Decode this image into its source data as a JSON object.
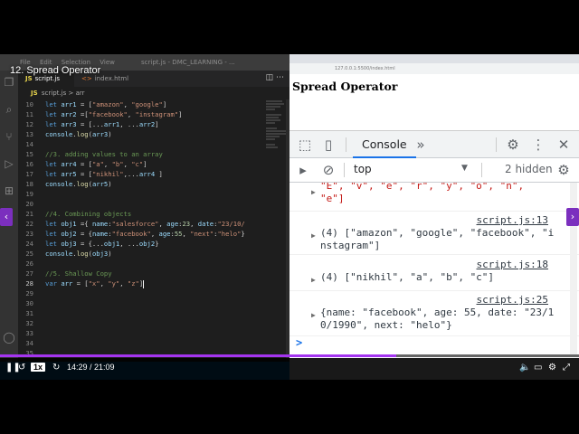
{
  "video": {
    "title": "12. Spread Operator",
    "speed": "1x",
    "time": "14:29 / 21:09",
    "progress": 0.685
  },
  "vscode": {
    "menu": [
      "File",
      "Edit",
      "Selection",
      "View"
    ],
    "window_title": "script.js - DMC_LEARNING - ...",
    "tabs": [
      {
        "icon": "JS",
        "label": "script.js"
      },
      {
        "icon": "<>",
        "label": "index.html"
      }
    ],
    "breadcrumb": {
      "icon": "JS",
      "file": "script.js",
      "sep": ">",
      "symbol": "arr"
    },
    "lines": [
      {
        "n": "10",
        "t": "let arr1 = [\"amazon\", \"google\"]"
      },
      {
        "n": "11",
        "t": "let arr2 =[\"facebook\", \"instagram\"]"
      },
      {
        "n": "12",
        "t": "let arr3 = [...arr1, ...arr2]"
      },
      {
        "n": "13",
        "t": "console.log(arr3)"
      },
      {
        "n": "14",
        "t": ""
      },
      {
        "n": "15",
        "t": "//3. adding values to an array"
      },
      {
        "n": "16",
        "t": "let arr4 = [\"a\", \"b\", \"c\"]"
      },
      {
        "n": "17",
        "t": "let arr5 = [\"nikhil\",...arr4 ]"
      },
      {
        "n": "18",
        "t": "console.log(arr5)"
      },
      {
        "n": "19",
        "t": ""
      },
      {
        "n": "20",
        "t": ""
      },
      {
        "n": "21",
        "t": "//4. Combining objects"
      },
      {
        "n": "22",
        "t": "let obj1 ={ name:\"salesforce\", age:23, date:\"23/10/"
      },
      {
        "n": "23",
        "t": "let obj2 = {name:\"facebook\", age:55, \"next\":\"helo\"}"
      },
      {
        "n": "24",
        "t": "let obj3 = {...obj1, ...obj2}"
      },
      {
        "n": "25",
        "t": "console.log(obj3)"
      },
      {
        "n": "26",
        "t": ""
      },
      {
        "n": "27",
        "t": "//5. Shallow Copy"
      },
      {
        "n": "28",
        "t": "var arr = [\"x\", \"y\", \"z\"]"
      },
      {
        "n": "29",
        "t": ""
      },
      {
        "n": "30",
        "t": ""
      },
      {
        "n": "31",
        "t": ""
      },
      {
        "n": "32",
        "t": ""
      },
      {
        "n": "33",
        "t": ""
      },
      {
        "n": "34",
        "t": ""
      },
      {
        "n": "35",
        "t": ""
      }
    ]
  },
  "browser": {
    "url": "127.0.0.1:5500/index.html",
    "page_heading": "Spread Operator",
    "devtools": {
      "active_tab": "Console",
      "context": "top",
      "hidden": "2 hidden",
      "messages": [
        {
          "src": "",
          "text": "\"E\", \"v\", \"e\", \"r\", \"y\", \"o\", \"n\",\n\"e\"]"
        },
        {
          "src": "script.js:13",
          "text": "(4) [\"amazon\", \"google\", \"facebook\", \"i\nnstagram\"]"
        },
        {
          "src": "script.js:18",
          "text": "(4) [\"nikhil\", \"a\", \"b\", \"c\"]"
        },
        {
          "src": "script.js:25",
          "text": "{name: \"facebook\", age: 55, date: \"23/1\n0/1990\", next: \"helo\"}"
        }
      ],
      "prompt": ">"
    }
  }
}
